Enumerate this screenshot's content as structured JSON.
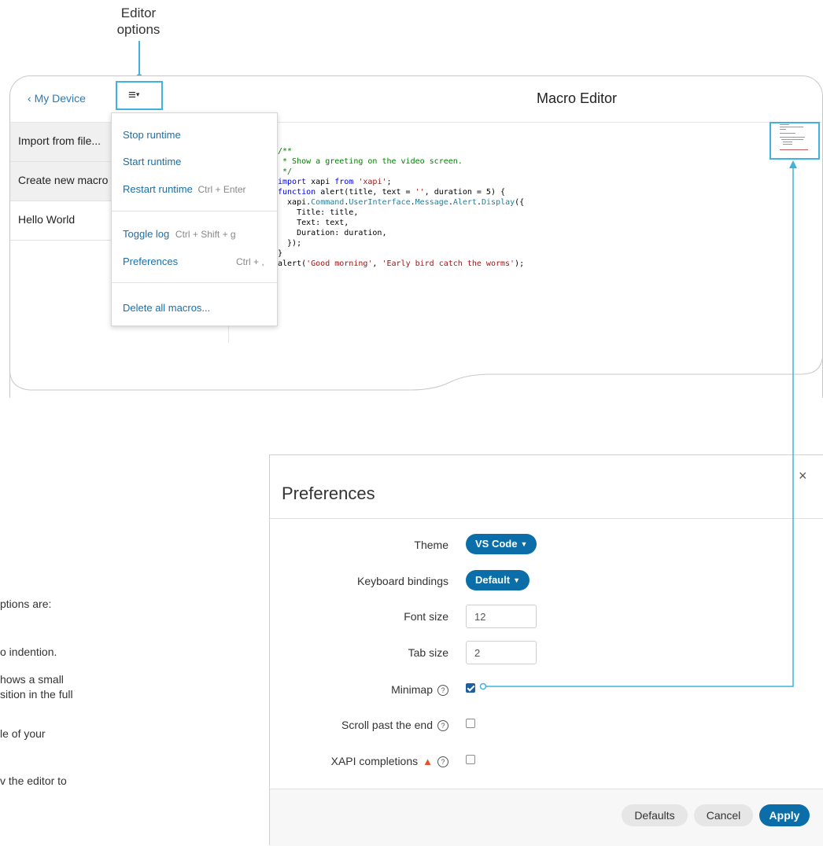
{
  "annotation": {
    "label_line1": "Editor",
    "label_line2": "options"
  },
  "header": {
    "back_label": "My Device",
    "menu_icon": "hamburger-caret-icon",
    "title": "Macro Editor"
  },
  "sidebar": {
    "items": [
      {
        "label": "Import from file..."
      },
      {
        "label": "Create new macro"
      },
      {
        "label": "Hello World"
      }
    ]
  },
  "dropdown": {
    "items": [
      {
        "label": "Stop runtime",
        "shortcut": ""
      },
      {
        "label": "Start runtime",
        "shortcut": ""
      },
      {
        "label": "Restart runtime",
        "shortcut": "Ctrl + Enter"
      },
      {
        "label": "Toggle log",
        "shortcut": "Ctrl + Shift + g"
      },
      {
        "label": "Preferences",
        "shortcut": "Ctrl + ,"
      },
      {
        "label": "Delete all macros...",
        "shortcut": ""
      }
    ]
  },
  "code_lines": [
    "/**",
    " * Show a greeting on the video screen.",
    " */",
    "",
    "import xapi from 'xapi';",
    "",
    "function alert(title, text = '', duration = 5) {",
    "  xapi.Command.UserInterface.Message.Alert.Display({",
    "    Title: title,",
    "    Text: text,",
    "    Duration: duration,",
    "  });",
    "}",
    "",
    "alert('Good morning', 'Early bird catch the worms');"
  ],
  "preferences": {
    "title": "Preferences",
    "theme_label": "Theme",
    "theme_value": "VS Code",
    "keyboard_label": "Keyboard bindings",
    "keyboard_value": "Default",
    "fontsize_label": "Font size",
    "fontsize_value": "12",
    "tabsize_label": "Tab size",
    "tabsize_value": "2",
    "minimap_label": "Minimap",
    "minimap_checked": true,
    "scroll_label": "Scroll past the end",
    "scroll_checked": false,
    "xapi_label": "XAPI completions",
    "xapi_checked": false,
    "help_glyph": "?",
    "warn_glyph": "▲",
    "close_glyph": "×",
    "defaults_button": "Defaults",
    "cancel_button": "Cancel",
    "apply_button": "Apply"
  },
  "body_fragments": [
    "ptions are:",
    "o indention.",
    "hows a small",
    "sition in the full",
    "le of your",
    "v the editor to"
  ],
  "colors": {
    "accent": "#0b6ea8",
    "callout": "#3fb3dd",
    "link": "#2a7ab8"
  }
}
